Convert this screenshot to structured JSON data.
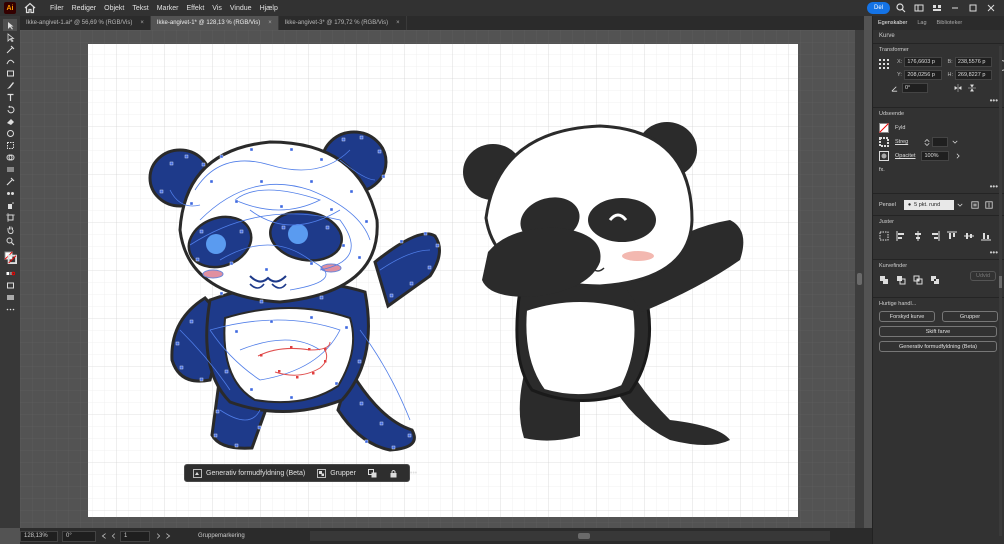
{
  "app": {
    "logo": "Ai"
  },
  "menu": [
    "Filer",
    "Rediger",
    "Objekt",
    "Tekst",
    "Marker",
    "Effekt",
    "Vis",
    "Vindue",
    "Hjælp"
  ],
  "share_label": "Del",
  "tabs": [
    {
      "label": "Ikke-angivet-1.ai* @ 56,69 % (RGB/Vis)"
    },
    {
      "label": "Ikke-angivet-1* @ 128,13 % (RGB/Vis)"
    },
    {
      "label": "Ikke-angivet-3* @ 179,72 % (RGB/Vis)"
    }
  ],
  "contextual_bar": {
    "generative_fill": "Generativ formudfyldning (Beta)",
    "group": "Grupper",
    "more": "•••"
  },
  "statusbar": {
    "zoom": "128,13%",
    "rotation": "0°",
    "artboard": "1",
    "status": "Gruppemarkering"
  },
  "panel": {
    "tabs": [
      "Egenskaber",
      "Lag",
      "Biblioteker"
    ],
    "kind": "Kurve",
    "transform": {
      "title": "Transformer",
      "x_label": "X:",
      "x": "176,6603 p",
      "y_label": "Y:",
      "y": "208,0256 p",
      "b_label": "B:",
      "b": "238,5576 p",
      "h_label": "H:",
      "h": "269,8227 p",
      "angle": "0°"
    },
    "appearance": {
      "title": "Udseende",
      "fill_label": "Fyld",
      "stroke_label": "Streg",
      "opacity_label": "Opacitet",
      "opacity_value": "100%",
      "fx": "fx."
    },
    "brush": {
      "label": "Pensel",
      "value": "5 pkt. rund"
    },
    "align": {
      "title": "Juster"
    },
    "pathfinder": {
      "title": "Kurvefinder",
      "expand": "Udvid"
    },
    "quick_actions": {
      "title": "Hurtige handl...",
      "offset_path": "Forskyd kurve",
      "group": "Grupper",
      "change_color": "Skift farve",
      "generative_fill": "Generativ formudfyldning (Beta)"
    },
    "more": "•••"
  }
}
